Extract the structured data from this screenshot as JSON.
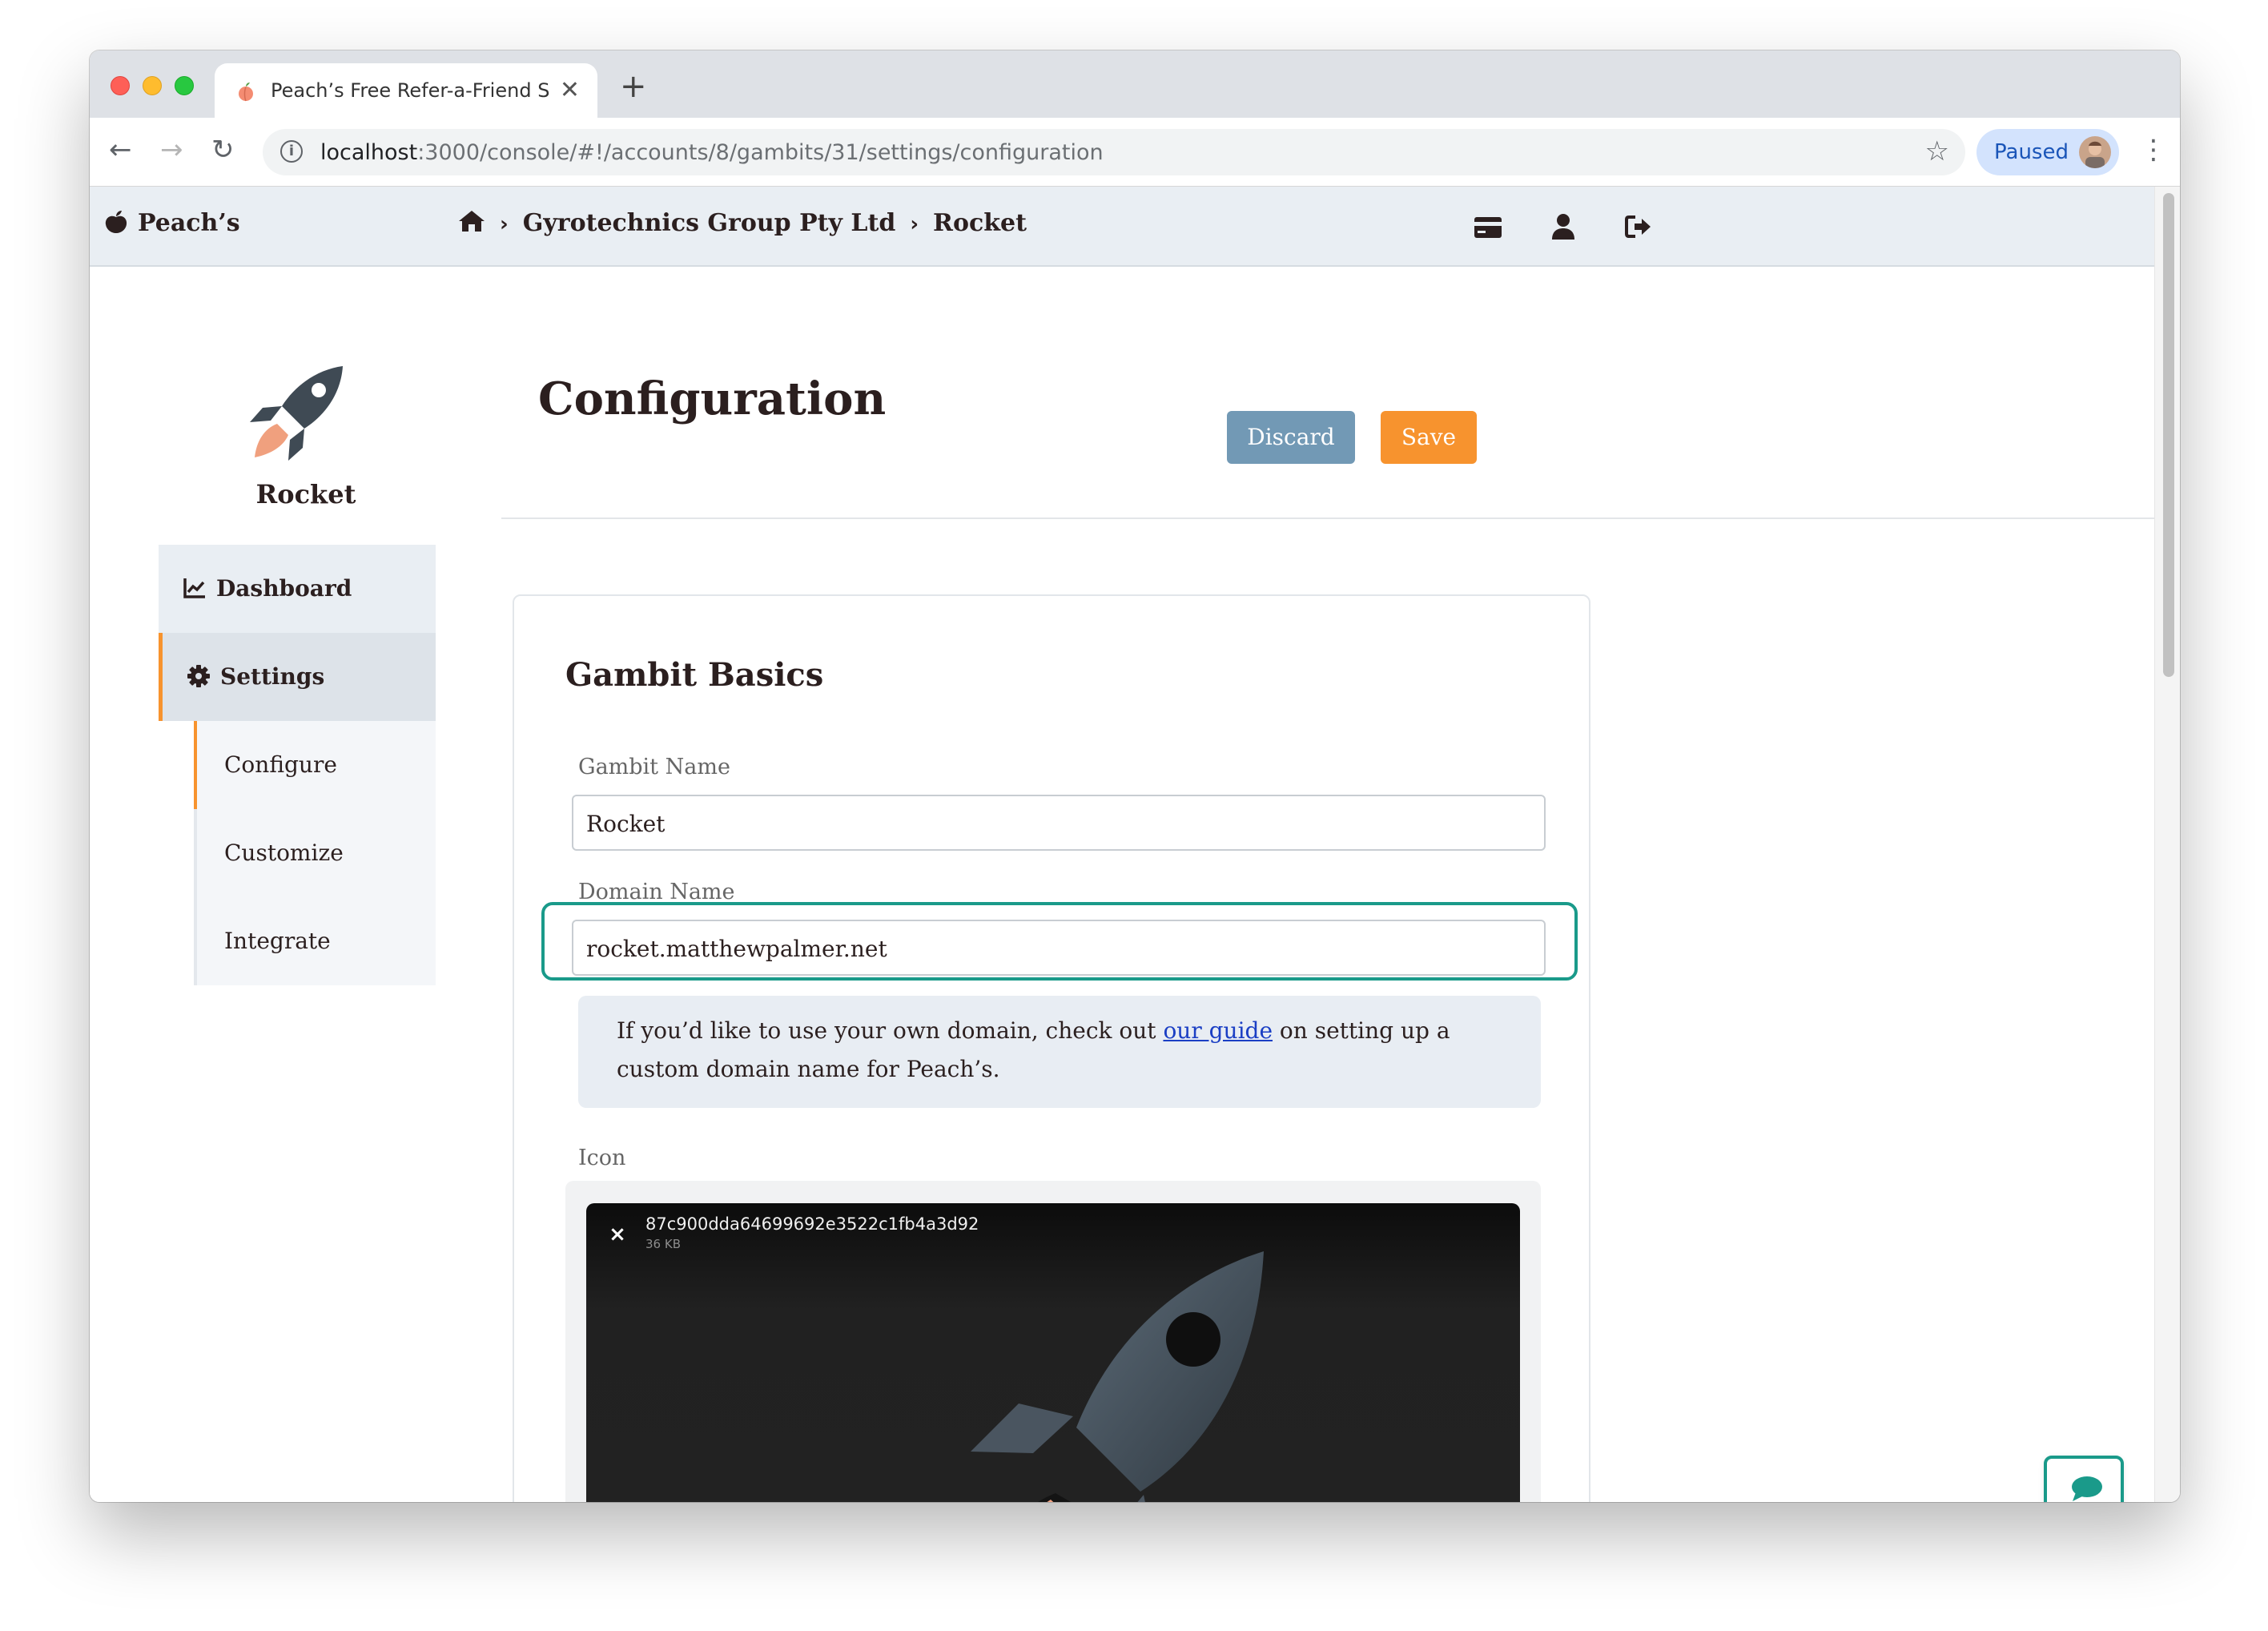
{
  "browser": {
    "tab_title": "Peach’s Free Refer-a-Friend S",
    "tab_close": "✕",
    "new_tab": "+",
    "url_host": "localhost",
    "url_rest": ":3000/console/#!/accounts/8/gambits/31/settings/configuration",
    "profile_label": "Paused"
  },
  "topnav": {
    "brand": "Peach’s",
    "breadcrumb_account": "Gyrotechnics Group Pty Ltd",
    "breadcrumb_gambit": "Rocket",
    "breadcrumb_separator": "›"
  },
  "sidebar": {
    "gambit_name": "Rocket",
    "items": [
      {
        "label": "Dashboard"
      },
      {
        "label": "Settings"
      }
    ],
    "submenu": [
      {
        "label": "Configure"
      },
      {
        "label": "Customize"
      },
      {
        "label": "Integrate"
      }
    ]
  },
  "header": {
    "title": "Configuration",
    "discard_label": "Discard",
    "save_label": "Save"
  },
  "form": {
    "section_title": "Gambit Basics",
    "gambit_name_label": "Gambit Name",
    "gambit_name_value": "Rocket",
    "domain_name_label": "Domain Name",
    "domain_name_value": "rocket.matthewpalmer.net",
    "help_before": "If you’d like to use your own domain, check out ",
    "help_link": "our guide",
    "help_after": " on setting up a custom domain name for Peach’s.",
    "icon_label": "Icon",
    "icon_file_name": "87c900dda64699692e3522c1fb4a3d92",
    "icon_file_size": "36 KB",
    "icon_remove": "×"
  },
  "colors": {
    "accent_orange": "#f7932e",
    "discard_blue": "#7299b5",
    "focus_teal": "#1a9a8a",
    "link_blue": "#1b3fc4"
  }
}
